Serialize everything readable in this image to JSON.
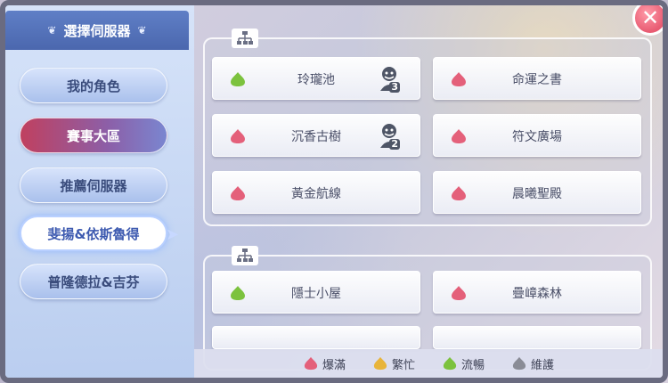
{
  "sidebar": {
    "title": "選擇伺服器",
    "items": [
      {
        "label": "我的角色"
      },
      {
        "label": "賽事大區"
      },
      {
        "label": "推薦伺服器"
      },
      {
        "label": "斐揚&依斯魯得"
      },
      {
        "label": "普隆德拉&吉芬"
      }
    ]
  },
  "groups": [
    {
      "servers": [
        {
          "name": "玲瓏池",
          "status": "green",
          "characters": "3"
        },
        {
          "name": "命運之書",
          "status": "red"
        },
        {
          "name": "沉香古樹",
          "status": "red",
          "characters": "2"
        },
        {
          "name": "符文廣場",
          "status": "red"
        },
        {
          "name": "黃金航線",
          "status": "red"
        },
        {
          "name": "晨曦聖殿",
          "status": "red"
        }
      ]
    },
    {
      "servers": [
        {
          "name": "隱士小屋",
          "status": "green"
        },
        {
          "name": "疊嶂森林",
          "status": "red"
        }
      ]
    }
  ],
  "legend": [
    {
      "label": "爆滿",
      "color": "#e4607a"
    },
    {
      "label": "繁忙",
      "color": "#e8b43a"
    },
    {
      "label": "流暢",
      "color": "#7cc23e"
    },
    {
      "label": "維護",
      "color": "#8a8c96"
    }
  ],
  "status_colors": {
    "green": "#7cc23e",
    "red": "#e4607a",
    "yellow": "#e8b43a",
    "gray": "#8a8c96"
  },
  "close_icon": "close-icon"
}
